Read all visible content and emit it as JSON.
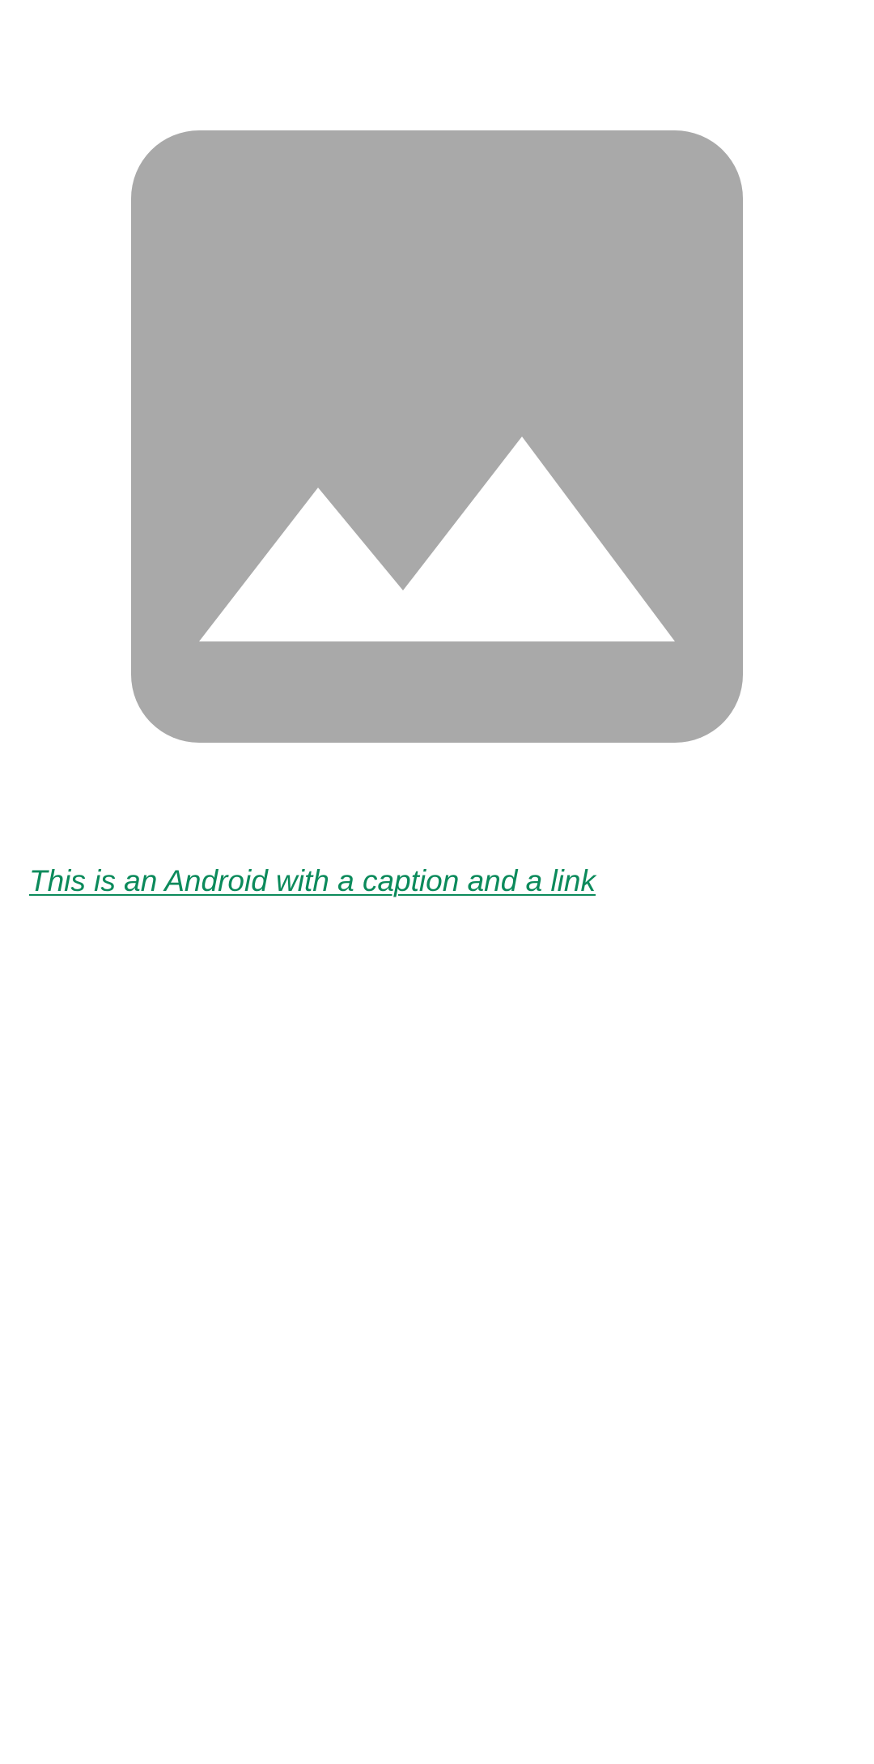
{
  "image": {
    "icon": "image-placeholder-icon",
    "background_color": "#A9A9A9",
    "mountain_color": "#FFFFFF"
  },
  "caption": {
    "text": "This is an Android with a caption and a link",
    "color": "#0B8A5B"
  }
}
